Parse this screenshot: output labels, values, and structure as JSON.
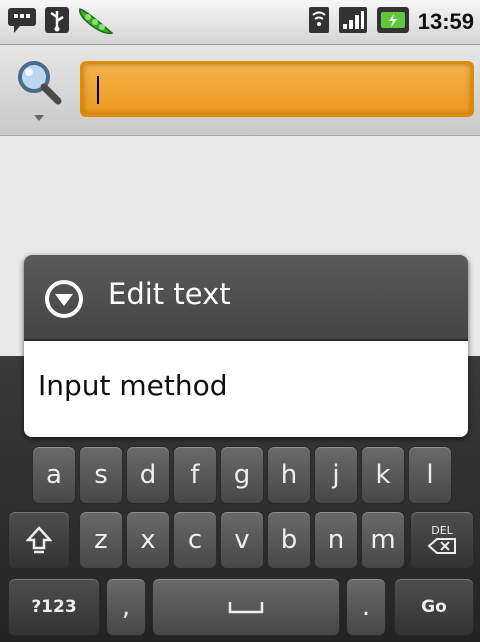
{
  "status_bar": {
    "time": "13:59",
    "left_icons": [
      "chat-icon",
      "usb-icon",
      "peapod-icon"
    ],
    "right_icons": [
      "wifi-icon",
      "signal-icon",
      "battery-icon"
    ]
  },
  "search": {
    "value": "",
    "placeholder": ""
  },
  "dialog": {
    "title": "Edit text",
    "items": [
      "Input method"
    ]
  },
  "keyboard": {
    "row2": [
      "a",
      "s",
      "d",
      "f",
      "g",
      "h",
      "j",
      "k",
      "l"
    ],
    "row3": [
      "z",
      "x",
      "c",
      "v",
      "b",
      "n",
      "m"
    ],
    "del_label": "DEL",
    "symbols_label": "?123",
    "comma_label": ",",
    "period_label": ".",
    "go_label": "Go"
  },
  "colors": {
    "search_accent": "#ec9a1e",
    "dialog_header": "#4e4e4e",
    "keyboard_bg": "#2e2e2e"
  }
}
